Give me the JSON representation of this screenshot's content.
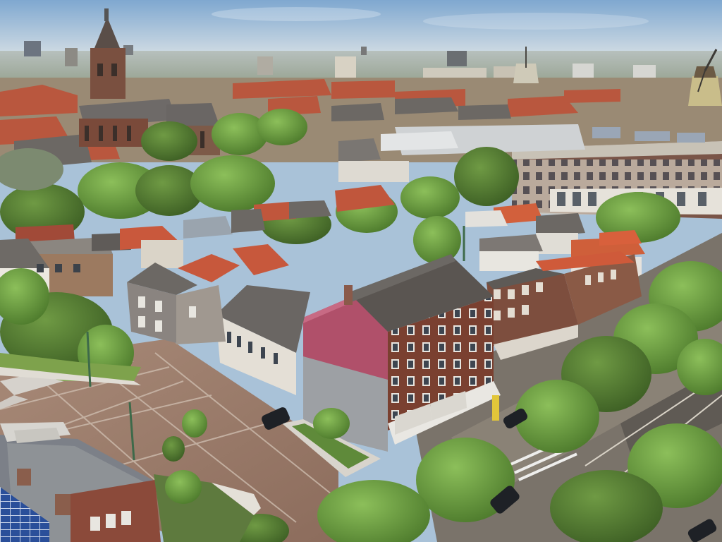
{
  "scene": {
    "palette": {
      "sky_top": "#8fb3d6",
      "sky_horizon": "#cdd9e3",
      "far_city": "#9aa3a0",
      "far_trees": "#6f8a5a",
      "roof_red": "#c0563c",
      "roof_grey": "#6e6a66",
      "brick": "#7a4a3a",
      "plaza": "#9a7a6a",
      "tree": "#6a9a3e",
      "tree_dark": "#4e7a2e",
      "road": "#6b6660",
      "pink_wrap": "#b5506a",
      "white_facade": "#dcdad4",
      "water_tower": "#d0c7a4"
    }
  }
}
